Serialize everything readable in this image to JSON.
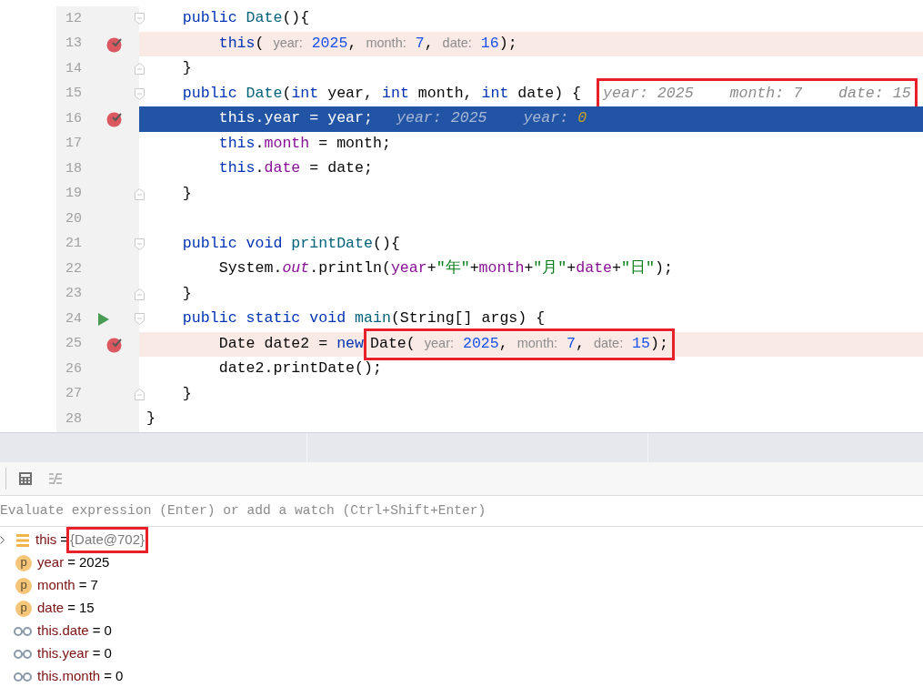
{
  "editor": {
    "lines": [
      {
        "number": "12",
        "breakpoint": false,
        "run_marker": false,
        "fold_start": true,
        "fold_end": false,
        "execution_point": false,
        "parts": [
          {
            "kind": "code",
            "boxed": false,
            "tokens": [
              {
                "kind": "kw",
                "text": "    public "
              },
              {
                "kind": "decl",
                "text": "Date"
              },
              {
                "kind": "plain",
                "text": "(){"
              }
            ]
          }
        ]
      },
      {
        "number": "13",
        "breakpoint": true,
        "run_marker": false,
        "fold_start": false,
        "fold_end": false,
        "execution_point": false,
        "parts": [
          {
            "kind": "code",
            "boxed": false,
            "tokens": [
              {
                "kind": "kw",
                "text": "        this"
              },
              {
                "kind": "plain",
                "text": "( "
              },
              {
                "kind": "hint",
                "text": "year:"
              },
              {
                "kind": "num",
                "text": " 2025"
              },
              {
                "kind": "plain",
                "text": ", "
              },
              {
                "kind": "hint",
                "text": "month:"
              },
              {
                "kind": "num",
                "text": " 7"
              },
              {
                "kind": "plain",
                "text": ", "
              },
              {
                "kind": "hint",
                "text": "date:"
              },
              {
                "kind": "num",
                "text": " 16"
              },
              {
                "kind": "plain",
                "text": ");"
              }
            ]
          }
        ]
      },
      {
        "number": "14",
        "breakpoint": false,
        "run_marker": false,
        "fold_start": false,
        "fold_end": true,
        "execution_point": false,
        "parts": [
          {
            "kind": "code",
            "boxed": false,
            "tokens": [
              {
                "kind": "plain",
                "text": "    }"
              }
            ]
          }
        ]
      },
      {
        "number": "15",
        "breakpoint": false,
        "run_marker": false,
        "fold_start": true,
        "fold_end": false,
        "execution_point": false,
        "parts": [
          {
            "kind": "code",
            "boxed": false,
            "tokens": [
              {
                "kind": "kw",
                "text": "    public "
              },
              {
                "kind": "decl",
                "text": "Date"
              },
              {
                "kind": "plain",
                "text": "("
              },
              {
                "kind": "kw",
                "text": "int"
              },
              {
                "kind": "plain",
                "text": " year, "
              },
              {
                "kind": "kw",
                "text": "int"
              },
              {
                "kind": "plain",
                "text": " month, "
              },
              {
                "kind": "kw",
                "text": "int"
              },
              {
                "kind": "plain",
                "text": " date) {"
              }
            ]
          },
          {
            "kind": "debug",
            "boxed": true,
            "tokens": [
              {
                "kind": "dbg",
                "text": "year: 2025    month: 7    date: 15"
              }
            ]
          }
        ]
      },
      {
        "number": "16",
        "breakpoint": true,
        "run_marker": false,
        "fold_start": false,
        "fold_end": false,
        "execution_point": true,
        "parts": [
          {
            "kind": "code",
            "boxed": false,
            "tokens": [
              {
                "kind": "kw",
                "text": "        this"
              },
              {
                "kind": "plain",
                "text": "."
              },
              {
                "kind": "field",
                "text": "year"
              },
              {
                "kind": "plain",
                "text": " = year;"
              }
            ]
          },
          {
            "kind": "debug",
            "boxed": false,
            "tokens": [
              {
                "kind": "dbg",
                "text": "year: 2025    year: "
              },
              {
                "kind": "changed",
                "text": "0"
              }
            ]
          }
        ]
      },
      {
        "number": "17",
        "breakpoint": false,
        "run_marker": false,
        "fold_start": false,
        "fold_end": false,
        "execution_point": false,
        "parts": [
          {
            "kind": "code",
            "boxed": false,
            "tokens": [
              {
                "kind": "kw",
                "text": "        this"
              },
              {
                "kind": "plain",
                "text": "."
              },
              {
                "kind": "field",
                "text": "month"
              },
              {
                "kind": "plain",
                "text": " = month;"
              }
            ]
          }
        ]
      },
      {
        "number": "18",
        "breakpoint": false,
        "run_marker": false,
        "fold_start": false,
        "fold_end": false,
        "execution_point": false,
        "parts": [
          {
            "kind": "code",
            "boxed": false,
            "tokens": [
              {
                "kind": "kw",
                "text": "        this"
              },
              {
                "kind": "plain",
                "text": "."
              },
              {
                "kind": "field",
                "text": "date"
              },
              {
                "kind": "plain",
                "text": " = date;"
              }
            ]
          }
        ]
      },
      {
        "number": "19",
        "breakpoint": false,
        "run_marker": false,
        "fold_start": false,
        "fold_end": true,
        "execution_point": false,
        "parts": [
          {
            "kind": "code",
            "boxed": false,
            "tokens": [
              {
                "kind": "plain",
                "text": "    }"
              }
            ]
          }
        ]
      },
      {
        "number": "20",
        "breakpoint": false,
        "run_marker": false,
        "fold_start": false,
        "fold_end": false,
        "execution_point": false
      },
      {
        "number": "21",
        "breakpoint": false,
        "run_marker": false,
        "fold_start": true,
        "fold_end": false,
        "execution_point": false,
        "parts": [
          {
            "kind": "code",
            "boxed": false,
            "tokens": [
              {
                "kind": "kw",
                "text": "    public void "
              },
              {
                "kind": "decl",
                "text": "printDate"
              },
              {
                "kind": "plain",
                "text": "(){"
              }
            ]
          }
        ]
      },
      {
        "number": "22",
        "breakpoint": false,
        "run_marker": false,
        "fold_start": false,
        "fold_end": false,
        "execution_point": false,
        "parts": [
          {
            "kind": "code",
            "boxed": false,
            "tokens": [
              {
                "kind": "plain",
                "text": "        System."
              },
              {
                "kind": "static",
                "text": "out"
              },
              {
                "kind": "plain",
                "text": ".println("
              },
              {
                "kind": "field",
                "text": "year"
              },
              {
                "kind": "plain",
                "text": "+"
              },
              {
                "kind": "str",
                "text": "\"年\""
              },
              {
                "kind": "plain",
                "text": "+"
              },
              {
                "kind": "field",
                "text": "month"
              },
              {
                "kind": "plain",
                "text": "+"
              },
              {
                "kind": "str",
                "text": "\"月\""
              },
              {
                "kind": "plain",
                "text": "+"
              },
              {
                "kind": "field",
                "text": "date"
              },
              {
                "kind": "plain",
                "text": "+"
              },
              {
                "kind": "str",
                "text": "\"日\""
              },
              {
                "kind": "plain",
                "text": ");"
              }
            ]
          }
        ]
      },
      {
        "number": "23",
        "breakpoint": false,
        "run_marker": false,
        "fold_start": false,
        "fold_end": true,
        "execution_point": false,
        "parts": [
          {
            "kind": "code",
            "boxed": false,
            "tokens": [
              {
                "kind": "plain",
                "text": "    }"
              }
            ]
          }
        ]
      },
      {
        "number": "24",
        "breakpoint": false,
        "run_marker": true,
        "fold_start": true,
        "fold_end": false,
        "execution_point": false,
        "parts": [
          {
            "kind": "code",
            "boxed": false,
            "tokens": [
              {
                "kind": "kw",
                "text": "    public static void "
              },
              {
                "kind": "decl",
                "text": "main"
              },
              {
                "kind": "plain",
                "text": "(String[] args) {"
              }
            ]
          }
        ]
      },
      {
        "number": "25",
        "breakpoint": true,
        "run_marker": false,
        "fold_start": false,
        "fold_end": false,
        "execution_point": false,
        "parts": [
          {
            "kind": "code",
            "boxed": false,
            "tokens": [
              {
                "kind": "plain",
                "text": "        Date date2 = "
              },
              {
                "kind": "kw",
                "text": "new"
              }
            ]
          },
          {
            "kind": "code",
            "boxed": true,
            "tokens": [
              {
                "kind": "plain",
                "text": "Date( "
              },
              {
                "kind": "hint",
                "text": "year:"
              },
              {
                "kind": "num",
                "text": " 2025"
              },
              {
                "kind": "plain",
                "text": ", "
              },
              {
                "kind": "hint",
                "text": "month:"
              },
              {
                "kind": "num",
                "text": " 7"
              },
              {
                "kind": "plain",
                "text": ", "
              },
              {
                "kind": "hint",
                "text": "date:"
              },
              {
                "kind": "num",
                "text": " 15"
              },
              {
                "kind": "plain",
                "text": ");"
              }
            ]
          }
        ]
      },
      {
        "number": "26",
        "breakpoint": false,
        "run_marker": false,
        "fold_start": false,
        "fold_end": false,
        "execution_point": false,
        "parts": [
          {
            "kind": "code",
            "boxed": false,
            "tokens": [
              {
                "kind": "plain",
                "text": "        date2.printDate();"
              }
            ]
          }
        ]
      },
      {
        "number": "27",
        "breakpoint": false,
        "run_marker": false,
        "fold_start": false,
        "fold_end": true,
        "execution_point": false,
        "parts": [
          {
            "kind": "code",
            "boxed": false,
            "tokens": [
              {
                "kind": "plain",
                "text": "    }"
              }
            ]
          }
        ]
      },
      {
        "number": "28",
        "breakpoint": false,
        "run_marker": false,
        "fold_start": false,
        "fold_end": false,
        "execution_point": false,
        "parts": [
          {
            "kind": "code",
            "boxed": false,
            "tokens": [
              {
                "kind": "plain",
                "text": "}"
              }
            ]
          }
        ]
      }
    ]
  },
  "debugger": {
    "evaluate": {
      "placeholder": "Evaluate expression (Enter) or add a watch (Ctrl+Shift+Enter)"
    },
    "variables": [
      {
        "kind": "object",
        "name": "this",
        "separator": "=",
        "value": "{Date@702}",
        "expandable": true,
        "boxed": true
      },
      {
        "kind": "param",
        "icon_letter": "p",
        "name": "year",
        "separator": "=",
        "value": "2025",
        "expandable": false,
        "boxed": false
      },
      {
        "kind": "param",
        "icon_letter": "p",
        "name": "month",
        "separator": "=",
        "value": "7",
        "expandable": false,
        "boxed": false
      },
      {
        "kind": "param",
        "icon_letter": "p",
        "name": "date",
        "separator": "=",
        "value": "15",
        "expandable": false,
        "boxed": false
      },
      {
        "kind": "watch",
        "name": "this.date",
        "separator": "=",
        "value": "0",
        "expandable": false,
        "boxed": false
      },
      {
        "kind": "watch",
        "name": "this.year",
        "separator": "=",
        "value": "0",
        "expandable": false,
        "boxed": false
      },
      {
        "kind": "watch",
        "name": "this.month",
        "separator": "=",
        "value": "0",
        "expandable": false,
        "boxed": false
      }
    ]
  }
}
